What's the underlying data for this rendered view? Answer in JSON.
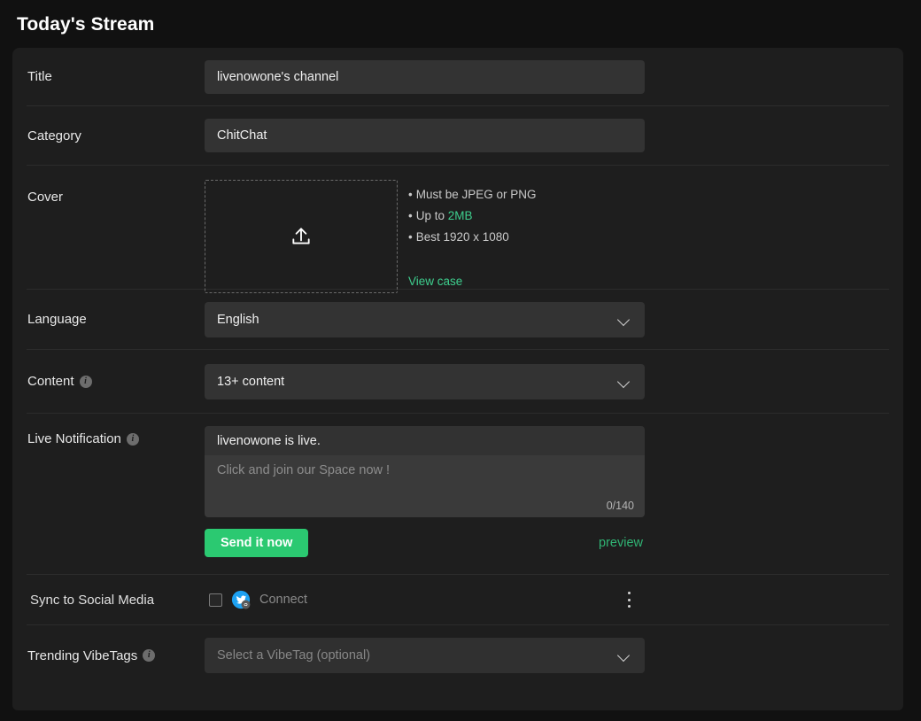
{
  "header": {
    "title": "Today's Stream"
  },
  "form": {
    "title_row": {
      "label": "Title",
      "value": "livenowone's channel"
    },
    "category_row": {
      "label": "Category",
      "value": "ChitChat"
    },
    "cover_row": {
      "label": "Cover",
      "upload_icon": "upload-icon",
      "notes": [
        "Must be JPEG or PNG",
        "Up to ",
        "Best 1920 x 1080"
      ],
      "note_1": "Must be JPEG or PNG",
      "note_2_prefix": "Up to ",
      "note_2_accent": "2MB",
      "note_3": "Best 1920 x 1080",
      "view_case": "View case"
    },
    "language_row": {
      "label": "Language",
      "value": "English"
    },
    "content_row": {
      "label": "Content",
      "value": "13+ content",
      "info_icon": "info-icon"
    },
    "notification_row": {
      "label": "Live Notification",
      "info_icon": "info-icon",
      "headline": "livenowone is live.",
      "placeholder": "Click and join our Space now !",
      "counter": "0/140",
      "send_label": "Send it now",
      "preview_label": "preview"
    },
    "sync_row": {
      "label": "Sync to Social Media",
      "connect_label": "Connect",
      "social_icon": "twitter-icon",
      "menu_icon": "kebab-menu-icon"
    },
    "tags_row": {
      "label": "Trending VibeTags",
      "placeholder": "Select a VibeTag (optional)",
      "info_icon": "info-icon"
    }
  },
  "colors": {
    "page_bg": "#111111",
    "card_bg": "#1e1e1e",
    "input_bg": "#333333",
    "accent_green": "#3ecf8e",
    "button_green": "#2bc971",
    "twitter_blue": "#1da1f2",
    "divider": "#2c2c2c"
  }
}
